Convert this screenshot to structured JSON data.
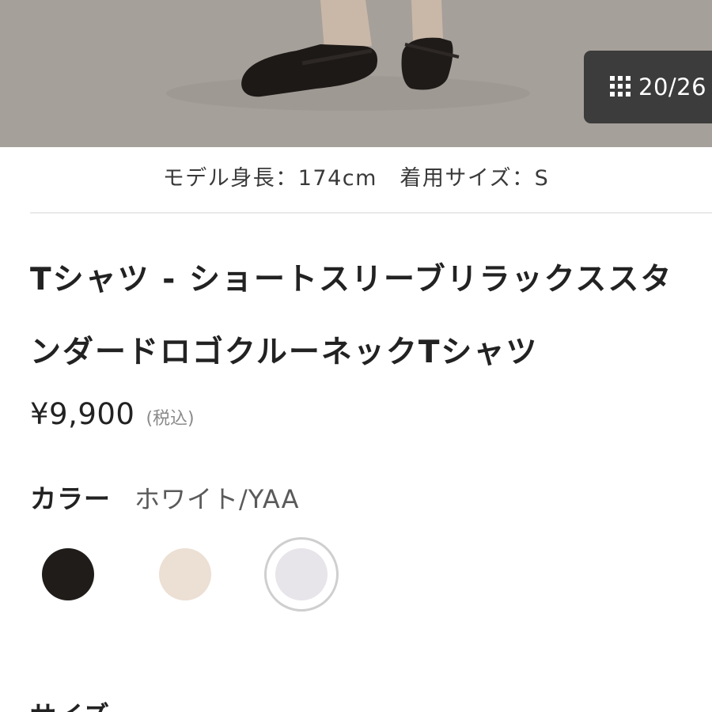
{
  "photo": {
    "alt": "",
    "counter": "20/26"
  },
  "model_info": "モデル身長：174cm　着用サイズ：S",
  "product": {
    "title_line1": "Tシャツ - ショートスリーブリラックススタ",
    "title_line2": "ンダードロゴクルーネックTシャツ",
    "price": "¥9,900",
    "tax_note": "(税込)"
  },
  "color": {
    "label": "カラー",
    "selected": "ホワイト/YAA",
    "swatches": [
      {
        "name": "black",
        "hex": "#1f1c1a",
        "selected": false
      },
      {
        "name": "beige",
        "hex": "#ecdfd3",
        "selected": false
      },
      {
        "name": "white",
        "hex": "#e7e4ea",
        "selected": true
      }
    ]
  },
  "size": {
    "label": "サイズ"
  },
  "colors": {
    "text": "#222222",
    "muted": "#8a8a8a",
    "counter_bg": "#3c3c3c",
    "divider": "#e9e9e9"
  },
  "icons": {
    "gallery": "grid-icon"
  }
}
